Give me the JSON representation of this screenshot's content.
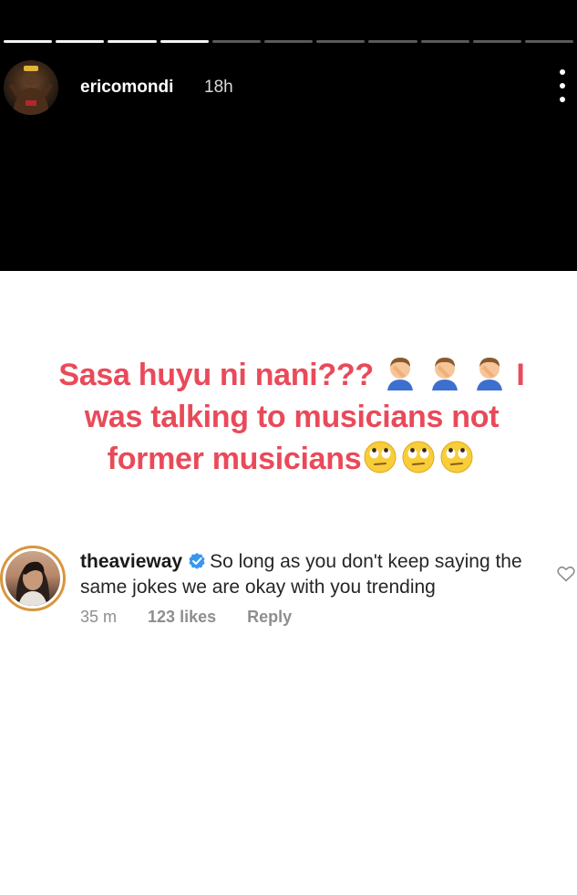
{
  "story": {
    "username": "ericomondi",
    "time": "18h",
    "progress_segments_total": 11,
    "progress_segments_done": 4,
    "text_line1": "Sasa huyu ni nani???",
    "text_line1_end": "I",
    "text_line2": "was talking to musicians not",
    "text_line3": "former musicians",
    "emoji_1": "facepalm-emoji",
    "emoji_2": "eye-roll-emoji",
    "accent_color": "#e94a5a"
  },
  "comment": {
    "username": "theavieway",
    "verified": true,
    "text": "So long as you don't keep saying the same jokes we are okay with you trending",
    "time": "35 m",
    "likes": "123 likes",
    "reply_label": "Reply"
  },
  "icons": {
    "more": "more-vertical-icon",
    "verified": "verified-badge-icon",
    "like": "heart-icon"
  }
}
